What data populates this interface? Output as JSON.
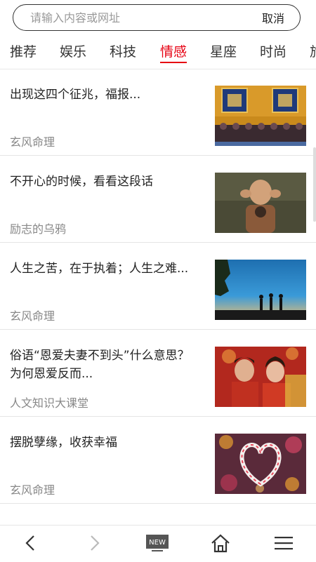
{
  "search": {
    "placeholder": "请输入内容或网址",
    "value": "",
    "cancel_label": "取消"
  },
  "tabs": [
    {
      "label": "推荐",
      "active": false
    },
    {
      "label": "娱乐",
      "active": false
    },
    {
      "label": "科技",
      "active": false
    },
    {
      "label": "情感",
      "active": true
    },
    {
      "label": "星座",
      "active": false
    },
    {
      "label": "时尚",
      "active": false
    },
    {
      "label": "旅",
      "active": false
    }
  ],
  "feed": [
    {
      "title": "出现这四个征兆，福报...",
      "source": "玄风命理",
      "image": "temple-gate-photo"
    },
    {
      "title": "不开心的时候，看看这段话",
      "source": "励志的乌鸦",
      "image": "little-monk-photo"
    },
    {
      "title": "人生之苦，在于执着；人生之难...",
      "source": "玄风命理",
      "image": "silhouette-sunset-photo"
    },
    {
      "title": "俗语“恩爱夫妻不到头”什么意思？为何恩爱反而...",
      "source": "人文知识大课堂",
      "image": "wedding-couple-photo"
    },
    {
      "title": "摆脱孽缘，收获幸福",
      "source": "玄风命理",
      "image": "heart-bokeh-photo"
    }
  ],
  "bottom_nav": {
    "back_icon": "chevron-left-icon",
    "forward_icon": "chevron-right-icon",
    "news_badge": "NEW",
    "home_icon": "home-icon",
    "menu_icon": "menu-icon"
  },
  "colors": {
    "accent": "#e60012",
    "text": "#222222",
    "muted": "#888888"
  }
}
